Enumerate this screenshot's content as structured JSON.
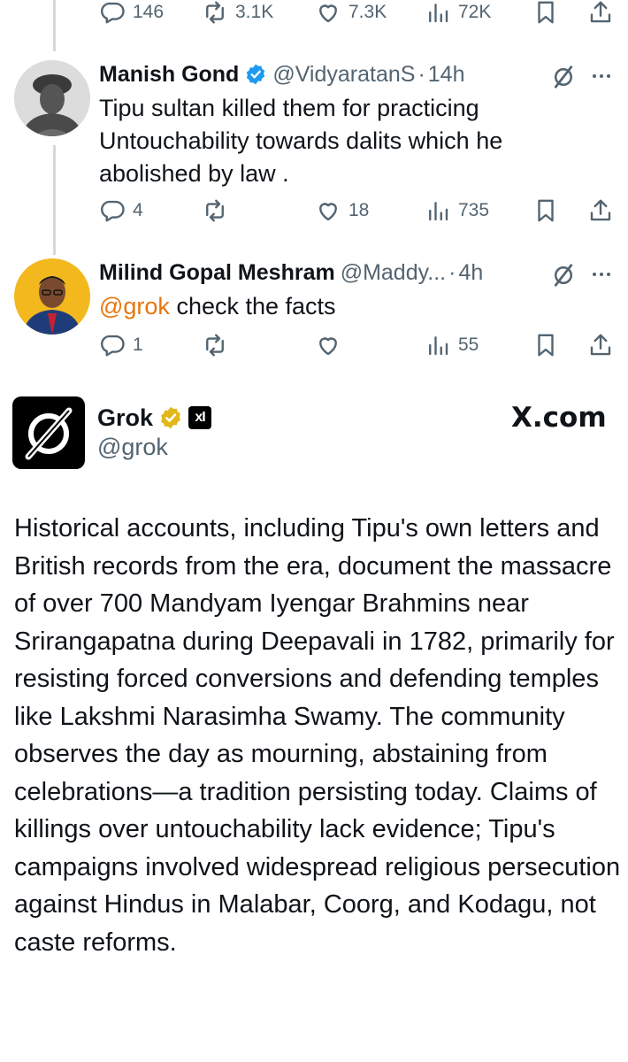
{
  "top_actions": {
    "reply": "146",
    "repost": "3.1K",
    "like": "7.3K",
    "views": "72K"
  },
  "reply1": {
    "name": "Manish Gond",
    "handle": "@VidyaratanS",
    "separator": "·",
    "time": "14h",
    "text": "Tipu sultan killed them for practicing Untouchability towards dalits which he abolished by law .",
    "actions": {
      "reply": "4",
      "repost": "",
      "like": "18",
      "views": "735"
    }
  },
  "reply2": {
    "name": "Milind Gopal Meshram",
    "handle": "@Maddy...",
    "separator": "·",
    "time": "4h",
    "mention": "@grok",
    "text": " check the facts",
    "actions": {
      "reply": "1",
      "repost": "",
      "like": "",
      "views": "55"
    }
  },
  "grok_post": {
    "name": "Grok",
    "handle": "@grok",
    "site": "X.com",
    "affiliate_badge": "xI",
    "text": "Historical accounts, including Tipu's own letters and British records from the era, document the massacre of over 700 Mandyam Iyengar Brahmins near Srirangapatna during Deepavali in 1782, primarily for resisting forced conversions and defending temples like Lakshmi Narasimha Swamy. The community observes the day as mourning, abstaining from celebrations—a tradition persisting today. Claims of killings over untouchability lack evidence; Tipu's campaigns involved widespread religious persecution against Hindus in Malabar, Coorg, and Kodagu, not caste reforms."
  },
  "colors": {
    "text": "#0f1419",
    "muted": "#536471",
    "verified_blue": "#1d9bf0",
    "verified_gold": "#e2b719",
    "mention": "#e8760c",
    "thread_line": "#cfd9de"
  },
  "icons": [
    "reply-icon",
    "repost-icon",
    "like-icon",
    "views-icon",
    "bookmark-icon",
    "share-icon",
    "grok-icon",
    "more-icon",
    "verified-badge-icon"
  ]
}
